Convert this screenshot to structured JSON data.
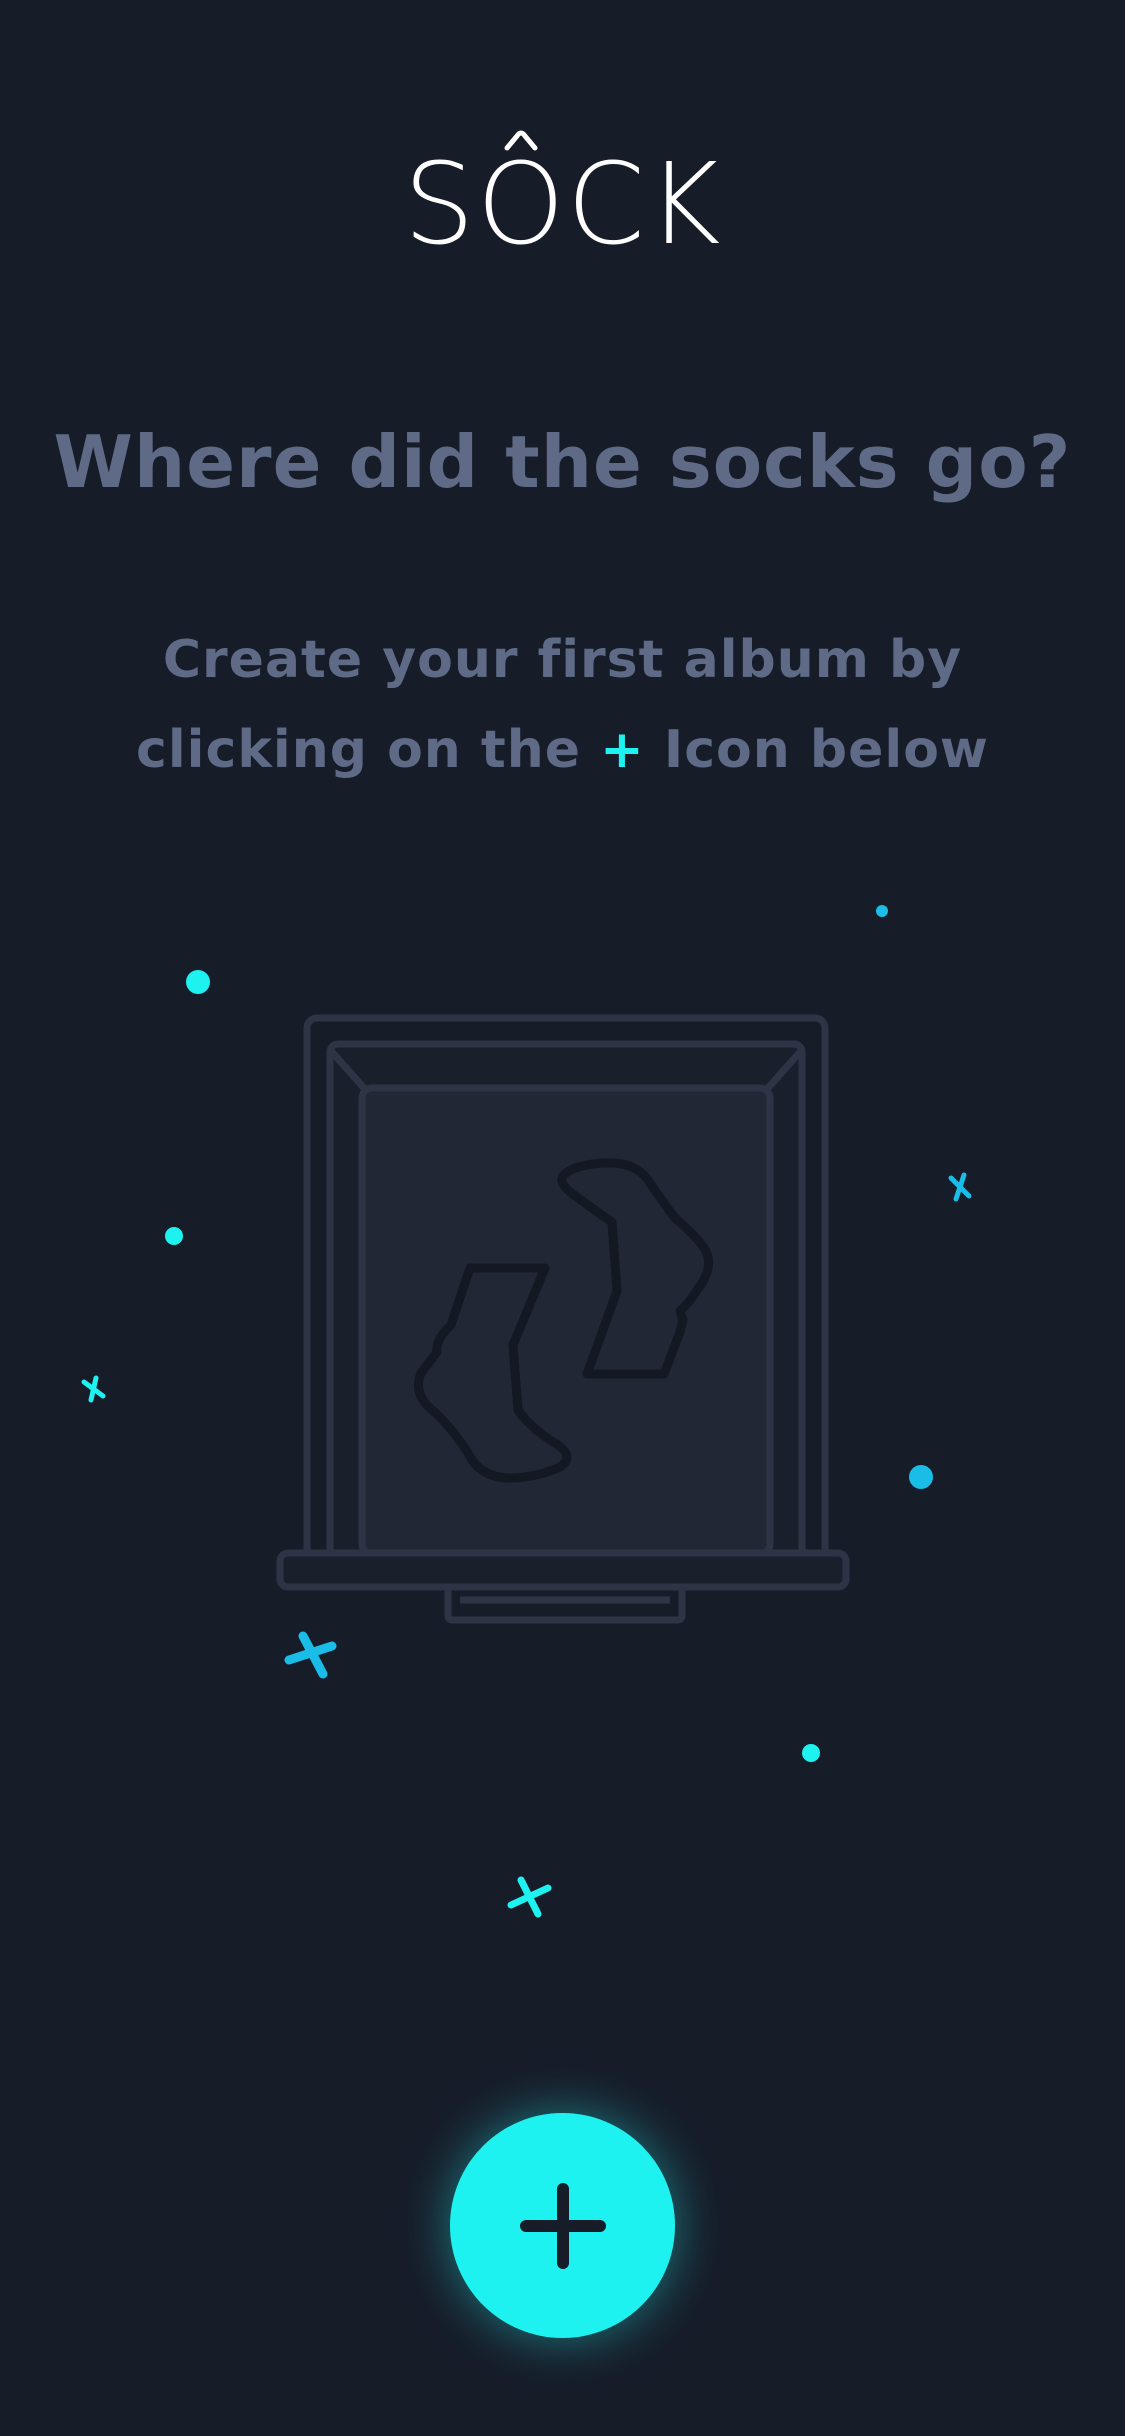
{
  "app": {
    "logo_text": "SOCK"
  },
  "empty_state": {
    "headline": "Where did the socks go?",
    "line1": "Create your first album by",
    "line2_before": "clicking on the",
    "line2_icon": "+",
    "line2_after": "Icon below"
  },
  "fab": {
    "icon": "plus-icon"
  },
  "colors": {
    "background": "#171c29",
    "accent": "#1ef2f0",
    "accent_secondary": "#19bde8",
    "muted_text": "#5f6b86",
    "illustration_stroke": "#2e3446",
    "illustration_fill": "#222736",
    "sock_stroke": "#141823"
  }
}
